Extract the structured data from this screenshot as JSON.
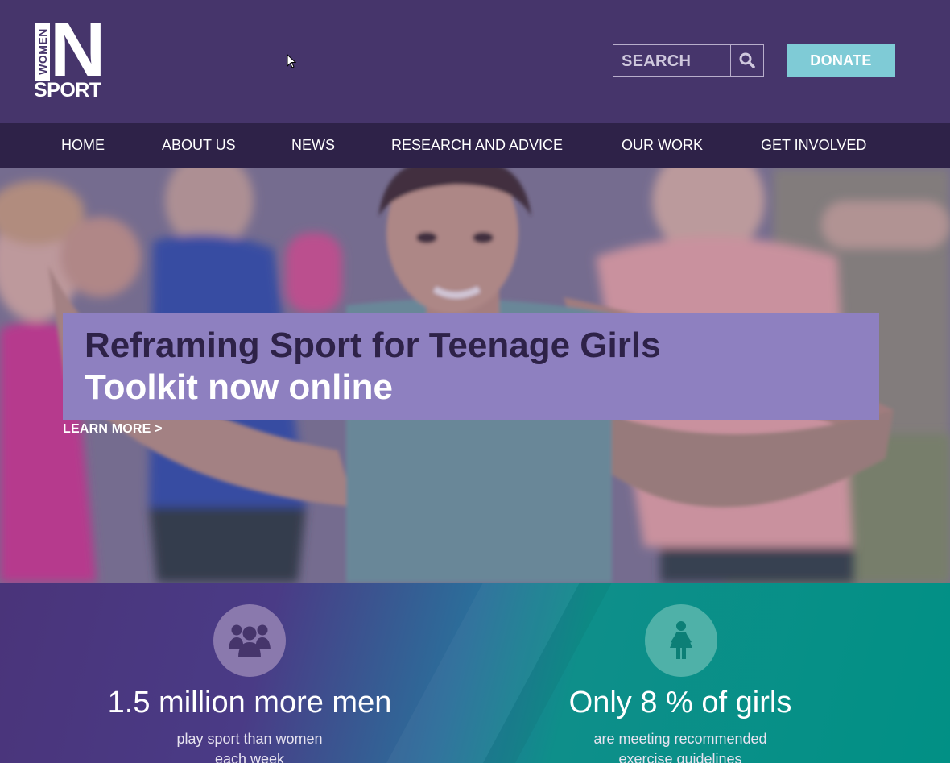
{
  "logo": {
    "women": "WOMEN",
    "letter": "N",
    "sport": "SPORT"
  },
  "header": {
    "search_placeholder": "SEARCH",
    "donate_label": "DONATE"
  },
  "nav": {
    "items": [
      {
        "label": "HOME"
      },
      {
        "label": "ABOUT US"
      },
      {
        "label": "NEWS"
      },
      {
        "label": "RESEARCH AND ADVICE"
      },
      {
        "label": "OUR WORK"
      },
      {
        "label": "GET INVOLVED"
      }
    ]
  },
  "hero": {
    "title": "Reframing Sport for Teenage Girls",
    "subtitle": "Toolkit now online",
    "link": "LEARN MORE >"
  },
  "stats": [
    {
      "icon": "group-icon",
      "headline": "1.5 million more men",
      "line1": "play sport than women",
      "line2": "each week"
    },
    {
      "icon": "girl-icon",
      "headline": "Only 8 % of girls",
      "line1": "are meeting recommended",
      "line2": "exercise guidelines"
    }
  ],
  "colors": {
    "header_bg": "#46356b",
    "nav_bg": "#2e2248",
    "donate_bg": "#7fcbd6",
    "hero_box_bg": "#8e80c0",
    "teal": "#019085"
  }
}
